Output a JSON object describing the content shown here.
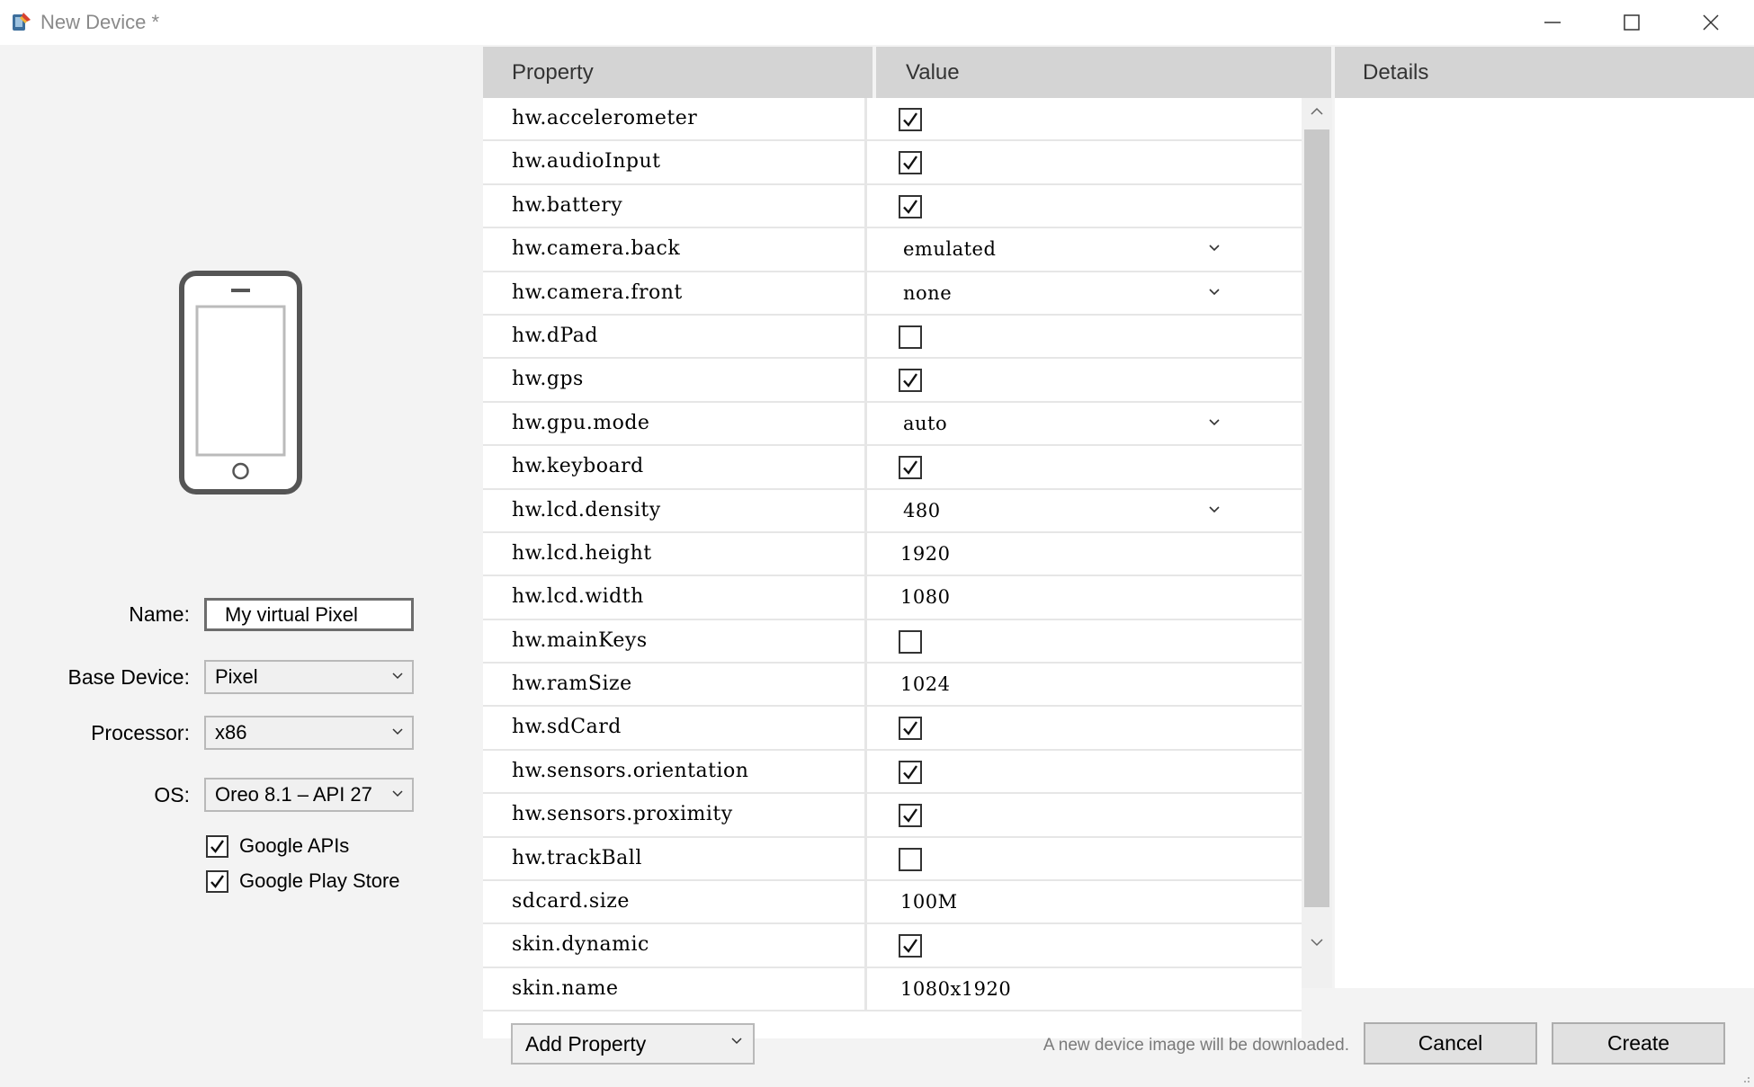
{
  "window": {
    "title": "New Device *",
    "icon": "android-studio-icon",
    "controls": [
      "minimize-icon",
      "maximize-icon",
      "close-icon"
    ]
  },
  "form": {
    "name_label": "Name:",
    "name_value": "My virtual Pixel",
    "base_device_label": "Base Device:",
    "base_device_value": "Pixel",
    "processor_label": "Processor:",
    "processor_value": "x86",
    "os_label": "OS:",
    "os_value": "Oreo 8.1 – API 27",
    "google_apis_label": "Google APIs",
    "google_apis_checked": true,
    "google_play_label": "Google Play Store",
    "google_play_checked": true
  },
  "grid": {
    "headers": {
      "property": "Property",
      "value": "Value",
      "details": "Details"
    },
    "rows": [
      {
        "property": "hw.accelerometer",
        "type": "check",
        "checked": true
      },
      {
        "property": "hw.audioInput",
        "type": "check",
        "checked": true
      },
      {
        "property": "hw.battery",
        "type": "check",
        "checked": true
      },
      {
        "property": "hw.camera.back",
        "type": "select",
        "value": "emulated"
      },
      {
        "property": "hw.camera.front",
        "type": "select",
        "value": "none"
      },
      {
        "property": "hw.dPad",
        "type": "check",
        "checked": false
      },
      {
        "property": "hw.gps",
        "type": "check",
        "checked": true
      },
      {
        "property": "hw.gpu.mode",
        "type": "select",
        "value": "auto"
      },
      {
        "property": "hw.keyboard",
        "type": "check",
        "checked": true
      },
      {
        "property": "hw.lcd.density",
        "type": "select",
        "value": "480"
      },
      {
        "property": "hw.lcd.height",
        "type": "text",
        "value": "1920"
      },
      {
        "property": "hw.lcd.width",
        "type": "text",
        "value": "1080"
      },
      {
        "property": "hw.mainKeys",
        "type": "check",
        "checked": false
      },
      {
        "property": "hw.ramSize",
        "type": "text",
        "value": "1024"
      },
      {
        "property": "hw.sdCard",
        "type": "check",
        "checked": true
      },
      {
        "property": "hw.sensors.orientation",
        "type": "check",
        "checked": true
      },
      {
        "property": "hw.sensors.proximity",
        "type": "check",
        "checked": true
      },
      {
        "property": "hw.trackBall",
        "type": "check",
        "checked": false
      },
      {
        "property": "sdcard.size",
        "type": "text",
        "value": "100M"
      },
      {
        "property": "skin.dynamic",
        "type": "check",
        "checked": true
      },
      {
        "property": "skin.name",
        "type": "text",
        "value": "1080x1920"
      }
    ]
  },
  "footer": {
    "add_property_label": "Add Property",
    "notice": "A new device image will be downloaded.",
    "cancel_label": "Cancel",
    "create_label": "Create"
  }
}
